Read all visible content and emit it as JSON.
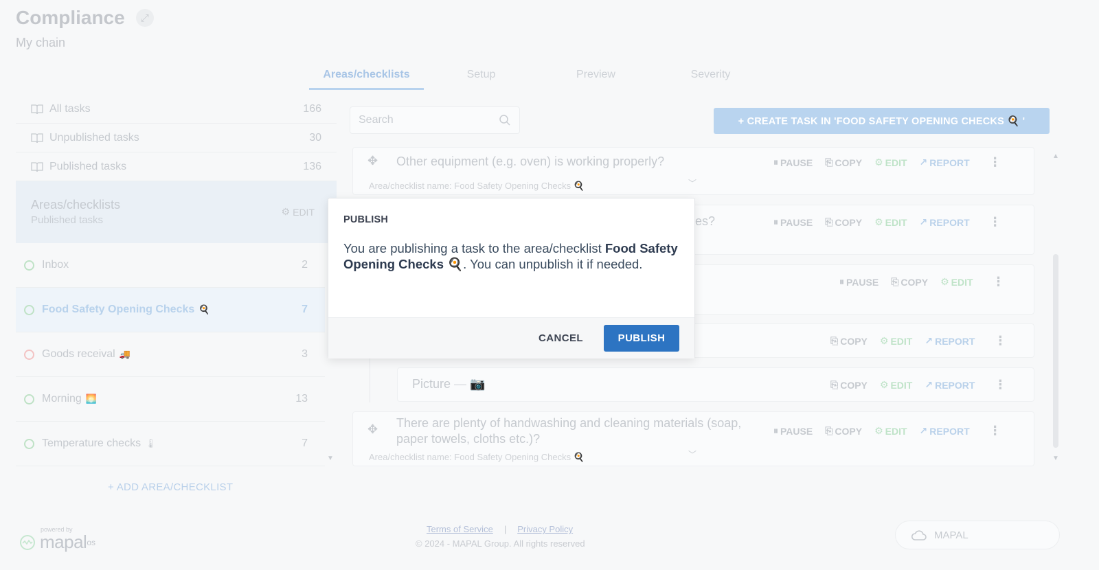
{
  "header": {
    "title": "Compliance",
    "subtitle": "My chain"
  },
  "tabs": [
    {
      "label": "Areas/checklists",
      "active": true
    },
    {
      "label": "Setup"
    },
    {
      "label": "Preview"
    },
    {
      "label": "Severity"
    }
  ],
  "sidebar": {
    "task_filters": [
      {
        "label": "All tasks",
        "count": "166"
      },
      {
        "label": "Unpublished tasks",
        "count": "30"
      },
      {
        "label": "Published tasks",
        "count": "136"
      }
    ],
    "areas_card": {
      "title": "Areas/checklists",
      "subtitle": "Published tasks",
      "edit_label": "EDIT"
    },
    "areas": [
      {
        "label": "Inbox",
        "emoji": "",
        "count": "2",
        "status": "green"
      },
      {
        "label": "Food Safety Opening Checks",
        "emoji": "🍳",
        "count": "7",
        "status": "green",
        "active": true
      },
      {
        "label": "Goods receival",
        "emoji": "🚚",
        "count": "3",
        "status": "red"
      },
      {
        "label": "Morning",
        "emoji": "🌅",
        "count": "13",
        "status": "green"
      },
      {
        "label": "Temperature checks",
        "emoji": "🌡",
        "count": "7",
        "status": "green"
      }
    ],
    "add_area_label": "+ ADD AREA/CHECKLIST"
  },
  "main": {
    "search_placeholder": "Search",
    "create_task_label": "+ CREATE TASK IN 'FOOD SAFETY OPENING CHECKS 🍳 '",
    "actions": {
      "pause": "PAUSE",
      "copy": "COPY",
      "edit": "EDIT",
      "report": "REPORT"
    },
    "tasks": [
      {
        "title": "Other equipment (e.g. oven) is working properly?",
        "meta": "Area/checklist name: Food Safety Opening Checks 🍳"
      },
      {
        "title_fragment": "es?"
      },
      {
        "title": "Picture"
      },
      {
        "title": "There are plenty of handwashing and cleaning materials (soap, paper towels, cloths etc.)?",
        "meta": "Area/checklist name: Food Safety Opening Checks 🍳"
      }
    ]
  },
  "modal": {
    "title": "PUBLISH",
    "body_prefix": "You are publishing a task to the area/checklist ",
    "body_bold": "Food Safety Opening Checks 🍳",
    "body_suffix": ". You can unpublish it if needed.",
    "cancel_label": "CANCEL",
    "publish_label": "PUBLISH"
  },
  "footer": {
    "terms": "Terms of Service",
    "separator": "|",
    "privacy": "Privacy Policy",
    "copyright": "© 2024 - MAPAL Group. All rights reserved",
    "powered_by": "powered by",
    "brand": "mapal",
    "brand_suffix": "os",
    "mapal_button": "MAPAL"
  },
  "colors": {
    "primary": "#2d74c2",
    "edit_green": "#bfe3c8",
    "report_blue": "#b9d1ea"
  }
}
